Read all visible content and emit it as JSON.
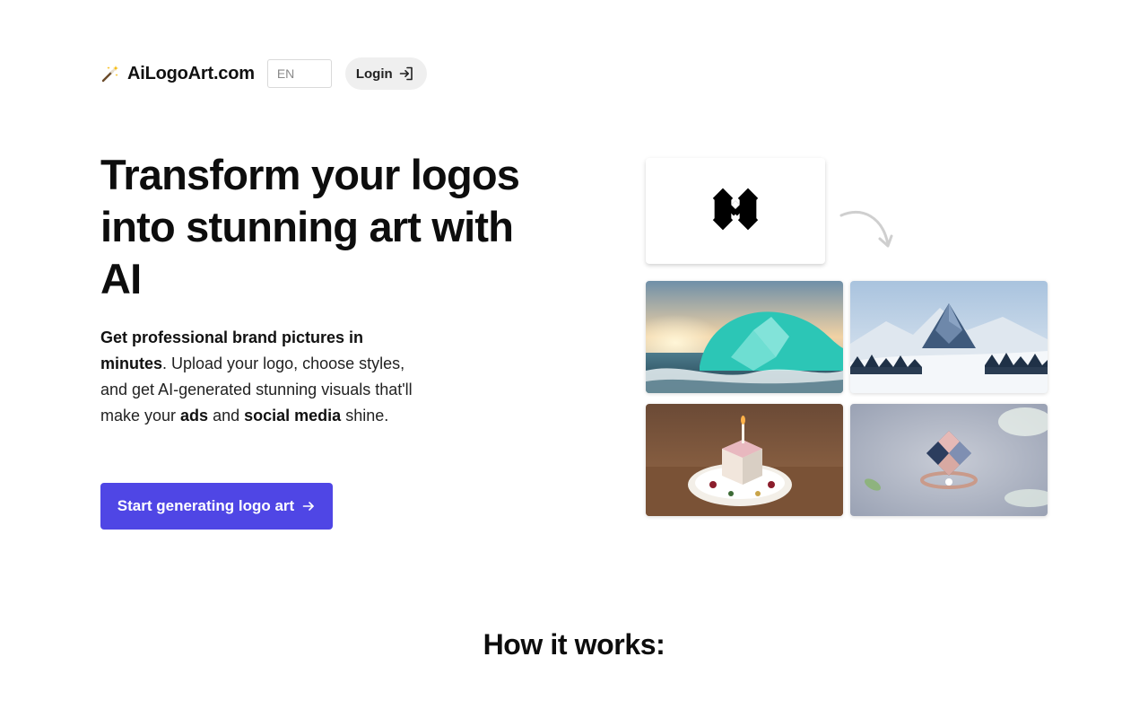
{
  "header": {
    "brand_name": "AiLogoArt.com",
    "brand_icon": "magic-wand-icon",
    "language": "EN",
    "login_label": "Login",
    "login_icon": "sign-in-icon"
  },
  "hero": {
    "title": "Transform your logos into stunning art with AI",
    "subtitle": {
      "lead_bold": "Get professional brand pictures in minutes",
      "text1": ". Upload your logo, choose styles, and get AI-generated stunning visuals that'll make your ",
      "bold_ads": "ads",
      "text2": " and ",
      "bold_social": "social media",
      "text3": " shine."
    },
    "cta_label": "Start generating logo art",
    "cta_icon": "arrow-right-icon"
  },
  "gallery": {
    "source_logo_icon": "diamond-logo-icon",
    "arrow_icon": "curved-arrow-icon",
    "images": [
      "ocean-wave-logo-art",
      "snowy-mountain-logo-art",
      "cake-candle-logo-art",
      "gem-ring-logo-art"
    ]
  },
  "how_it_works": {
    "title": "How it works:"
  },
  "colors": {
    "accent": "#4f46e5",
    "text": "#111111",
    "login_bg": "#efefef"
  }
}
